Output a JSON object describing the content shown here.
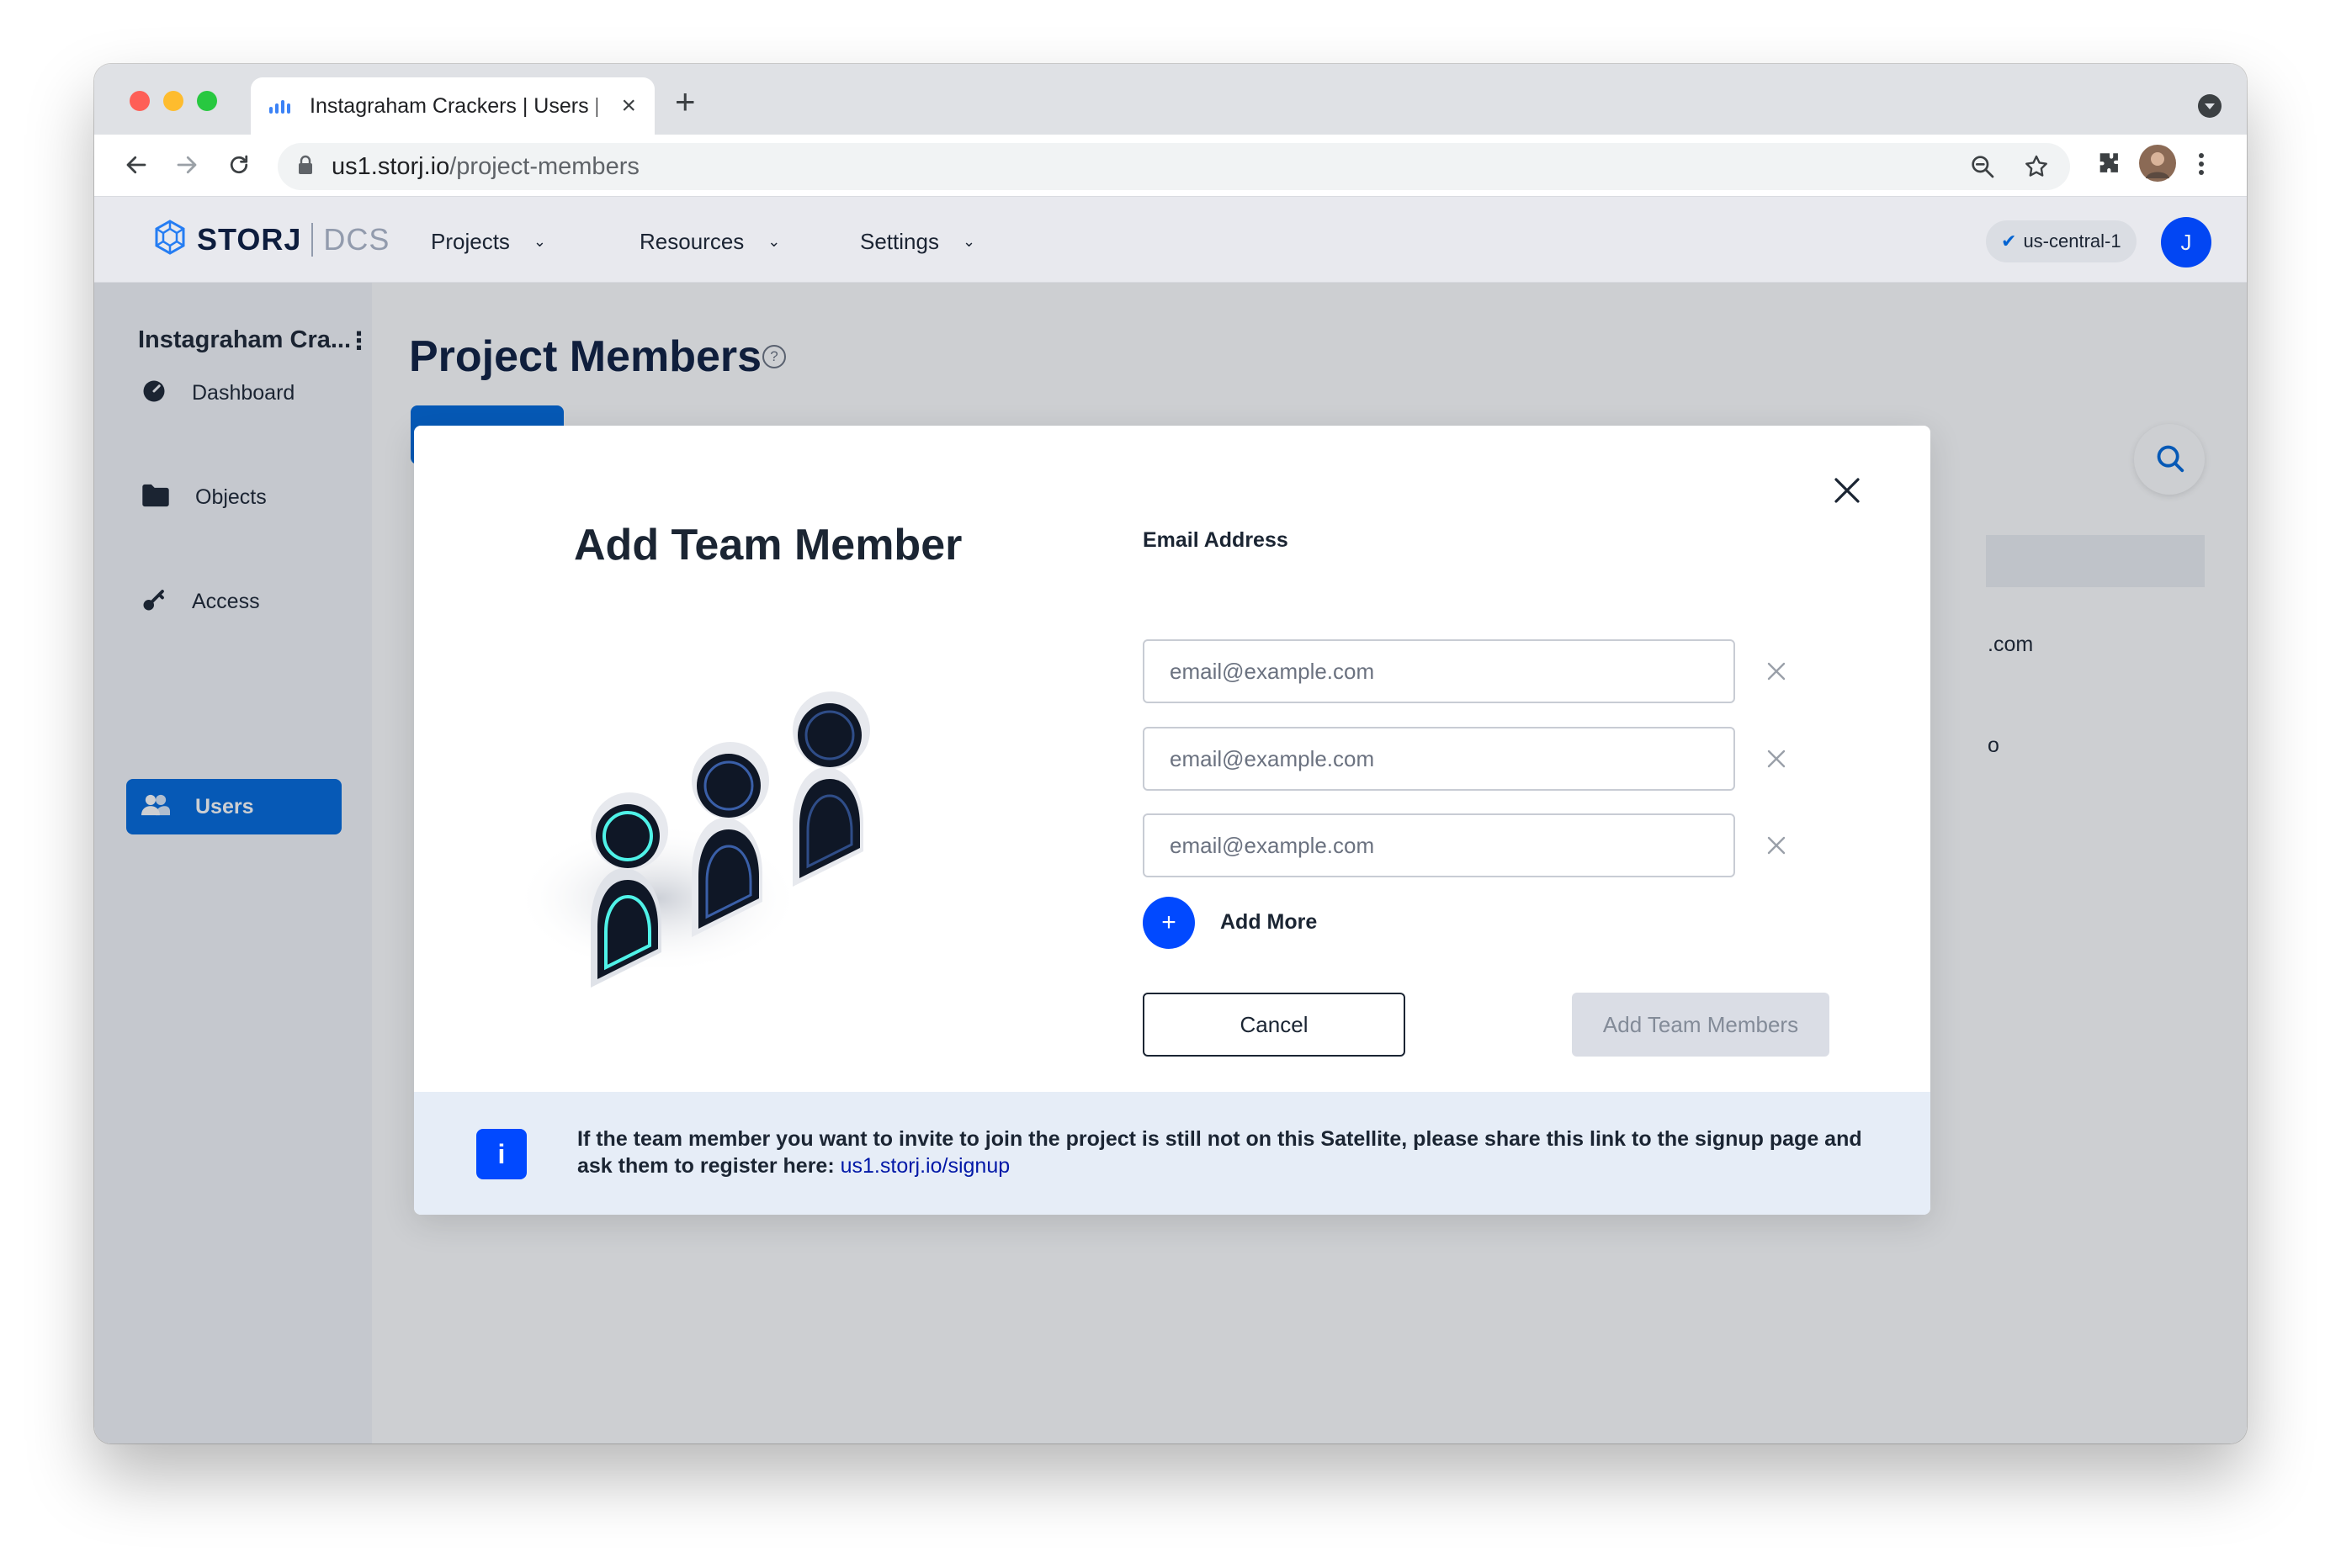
{
  "browser": {
    "tab_title": "Instagraham Crackers | Users |",
    "url_host": "us1.storj.io",
    "url_path": "/project-members"
  },
  "header": {
    "logo_word": "STORJ",
    "logo_sub": "DCS",
    "nav": [
      "Projects",
      "Resources",
      "Settings"
    ],
    "region": "us-central-1",
    "avatar_initial": "J"
  },
  "sidebar": {
    "project_name": "Instagraham Cra...",
    "items": [
      {
        "label": "Dashboard",
        "icon": "dashboard-icon"
      },
      {
        "label": "Objects",
        "icon": "folder-icon"
      },
      {
        "label": "Access",
        "icon": "key-icon"
      },
      {
        "label": "Users",
        "icon": "users-icon",
        "active": true
      }
    ]
  },
  "main": {
    "title": "Project Members",
    "help_symbol": "?",
    "background_cells": [
      ".com",
      "o"
    ]
  },
  "modal": {
    "title": "Add Team Member",
    "email_label": "Email Address",
    "email_placeholder": "email@example.com",
    "add_more_symbol": "+",
    "add_more_label": "Add More",
    "cancel_label": "Cancel",
    "submit_label": "Add Team Members",
    "info_symbol": "i",
    "info_text": "If the team member you want to invite to join the project is still not on this Satellite, please share this link to the signup page and ask them to register here: ",
    "info_link": "us1.storj.io/signup"
  },
  "colors": {
    "accent": "#0149ff",
    "sidebar_active": "#0068dc",
    "info_bar": "#e6edf7"
  }
}
